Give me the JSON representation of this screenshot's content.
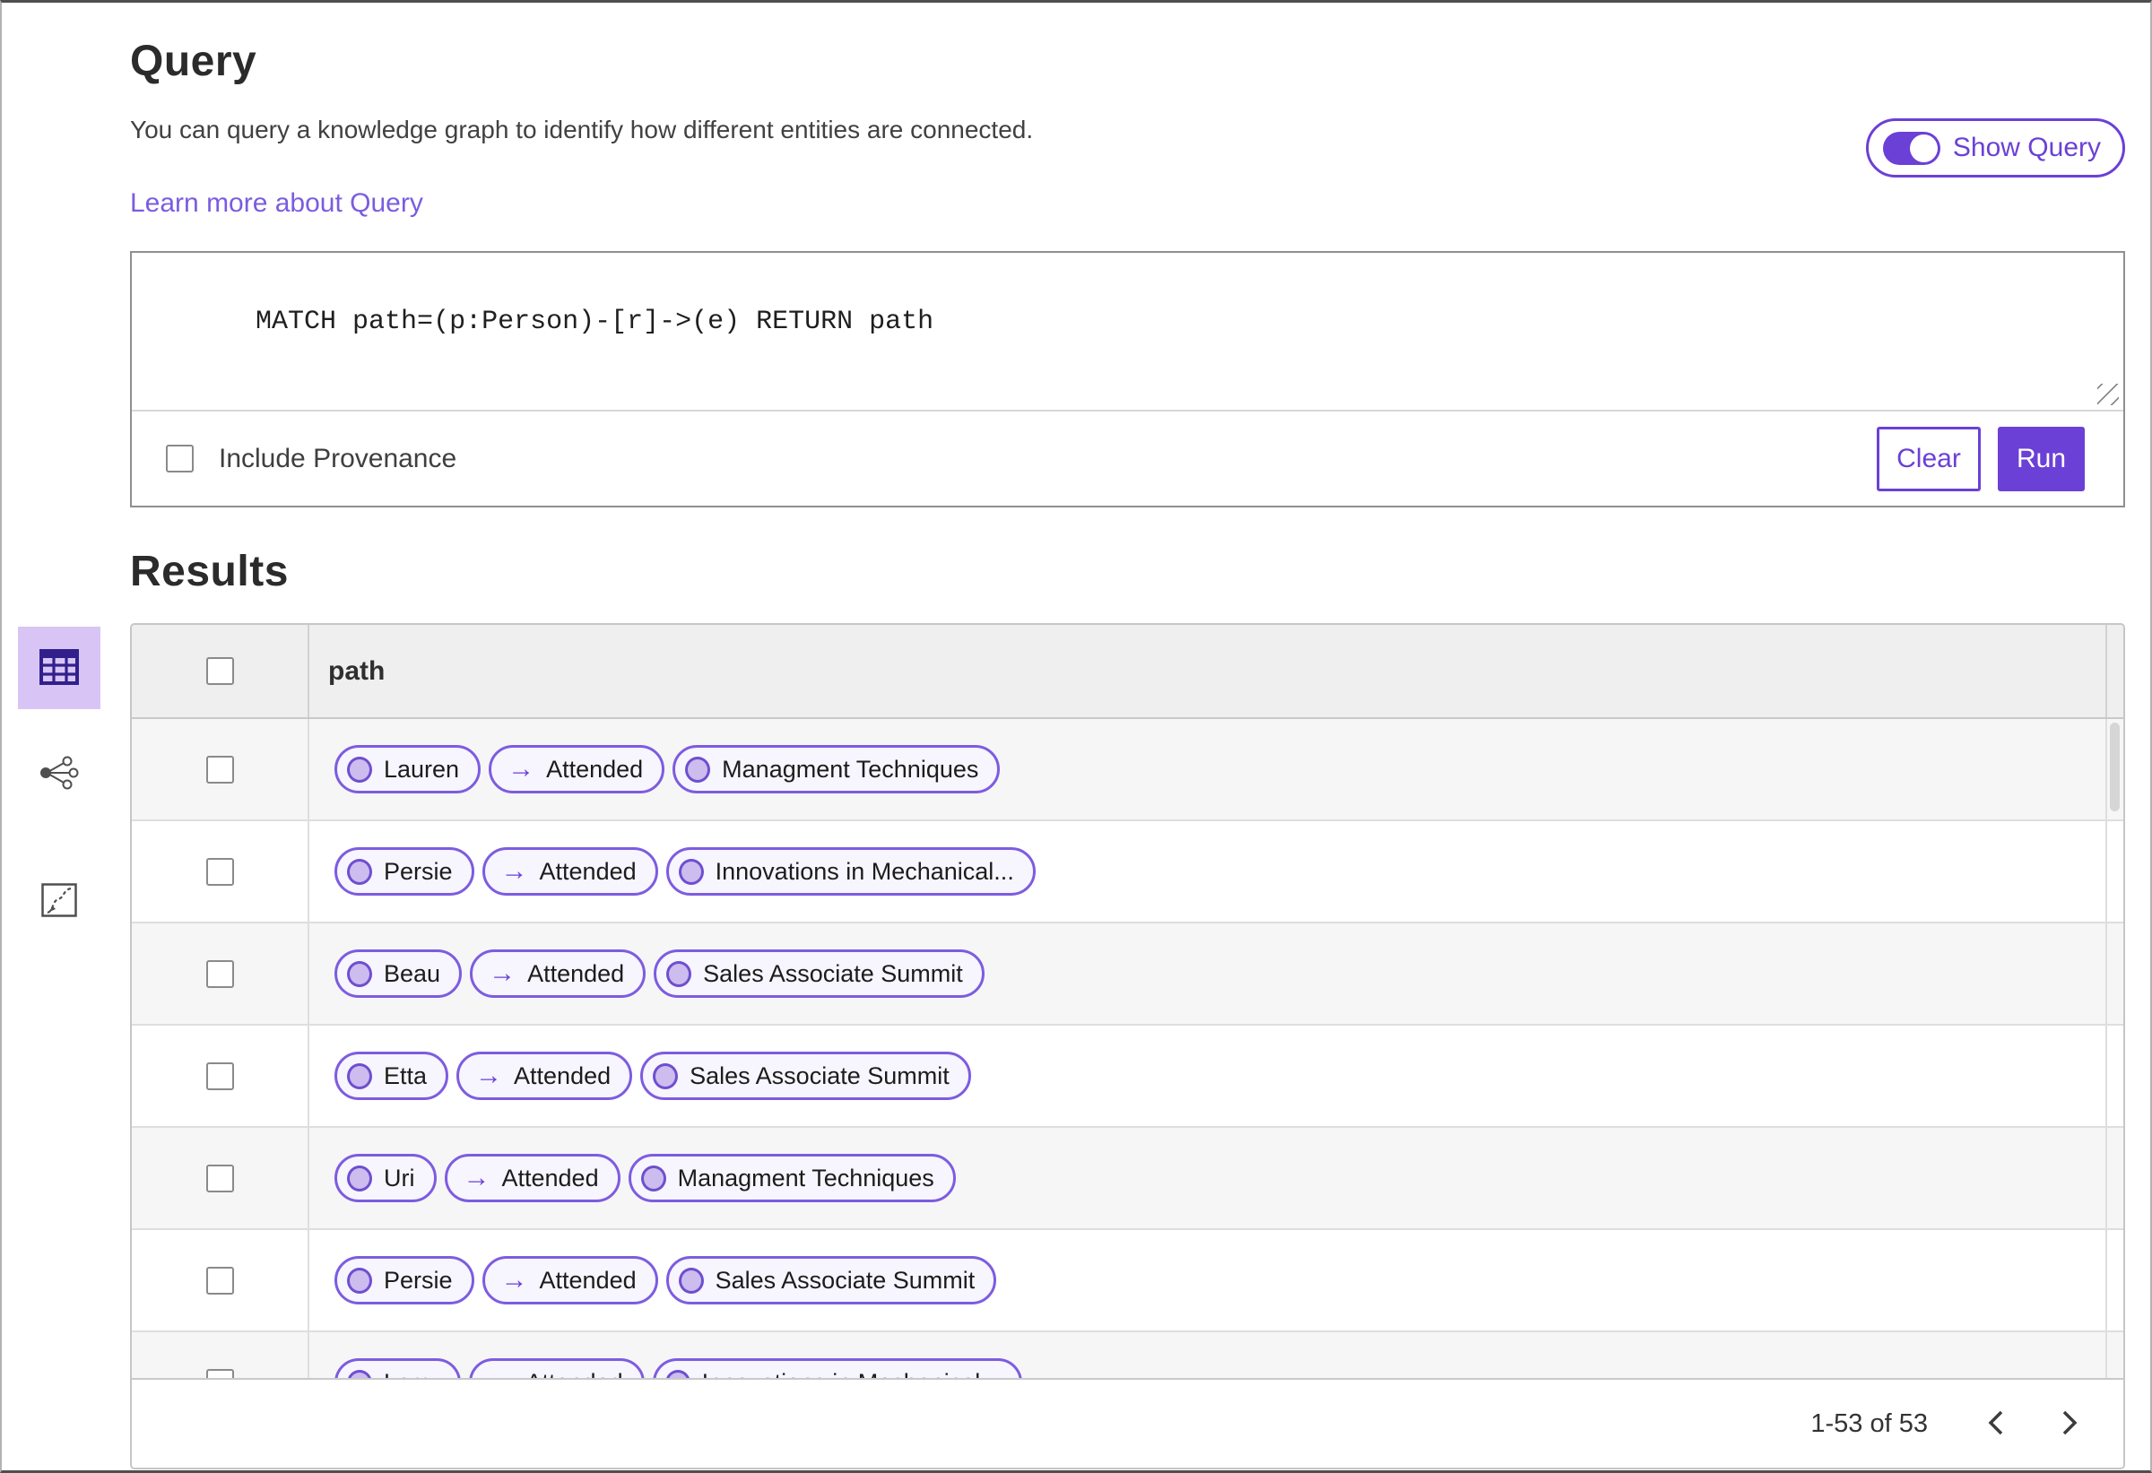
{
  "header": {
    "title": "Query",
    "description": "You can query a knowledge graph to identify how different entities are connected.",
    "learn_more_label": "Learn more about Query",
    "show_query_label": "Show Query",
    "show_query_on": true
  },
  "query_panel": {
    "query_text": "MATCH path=(p:Person)-[r]->(e) RETURN path",
    "include_provenance_label": "Include Provenance",
    "include_provenance_checked": false,
    "clear_label": "Clear",
    "run_label": "Run"
  },
  "results": {
    "title": "Results",
    "view_modes": [
      {
        "icon": "table-view-icon",
        "selected": true
      },
      {
        "icon": "graph-view-icon",
        "selected": false
      },
      {
        "icon": "chart-view-icon",
        "selected": false
      }
    ],
    "column_header": "path",
    "edge_arrow_glyph": "→",
    "rows": [
      {
        "source": "Lauren",
        "edge": "Attended",
        "target": "Managment Techniques"
      },
      {
        "source": "Persie",
        "edge": "Attended",
        "target": "Innovations in Mechanical..."
      },
      {
        "source": "Beau",
        "edge": "Attended",
        "target": "Sales Associate Summit"
      },
      {
        "source": "Etta",
        "edge": "Attended",
        "target": "Sales Associate Summit"
      },
      {
        "source": "Uri",
        "edge": "Attended",
        "target": "Managment Techniques"
      },
      {
        "source": "Persie",
        "edge": "Attended",
        "target": "Sales Associate Summit"
      },
      {
        "source": "Larry",
        "edge": "Attended",
        "target": "Innovations in Mechanical..."
      }
    ],
    "pagination": {
      "range_label": "1-53 of 53"
    }
  },
  "colors": {
    "accent": "#6b40d6",
    "link": "#7a5ce0",
    "pill_border": "#7d5ce0",
    "pill_background": "#f7f5fd",
    "node_fill": "#cdbcee",
    "node_border": "#6d4fd0",
    "selected_view_background": "#d8c5f5",
    "table_header_background": "#efefef",
    "row_alt_background": "#f6f6f6"
  }
}
